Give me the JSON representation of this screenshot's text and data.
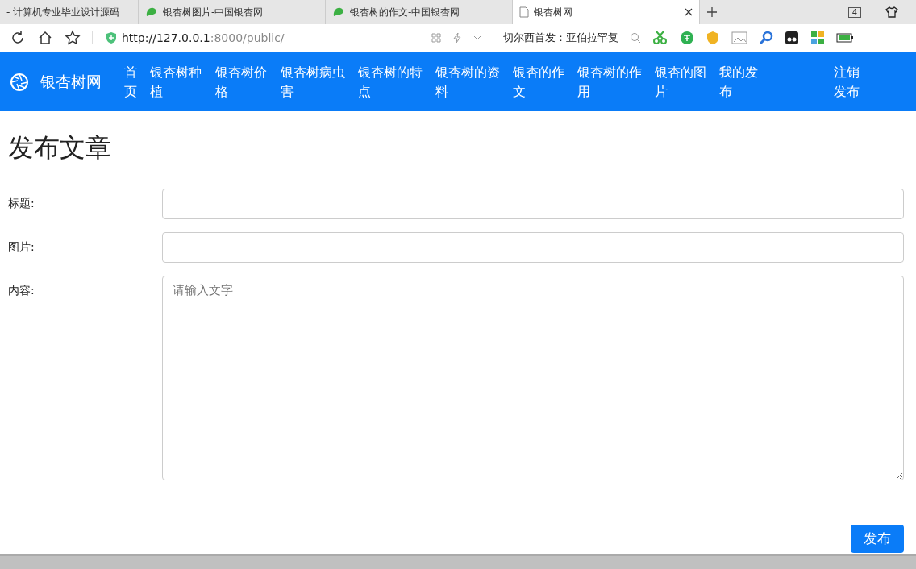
{
  "browser": {
    "tabs": [
      {
        "title": "- 计算机专业毕业设计源码",
        "kind": "plain",
        "selected": false
      },
      {
        "title": "银杏树图片-中国银杏网",
        "kind": "leaf",
        "selected": false
      },
      {
        "title": "银杏树的作文-中国银杏网",
        "kind": "leaf",
        "selected": false
      },
      {
        "title": "银杏树网",
        "kind": "page",
        "selected": true
      }
    ],
    "tab_count": "4",
    "url_host": "http://127.0.0.1",
    "url_rest": ":8000/public/",
    "search_text": "切尔西首发：亚伯拉罕复"
  },
  "navbar": {
    "brand": "银杏树网",
    "items": [
      {
        "label": "首页"
      },
      {
        "label": "银杏树种植"
      },
      {
        "label": "银杏树价格"
      },
      {
        "label": "银杏树病虫害"
      },
      {
        "label": "银杏树的特点"
      },
      {
        "label": "银杏树的资料"
      },
      {
        "label": "银杏的作文"
      },
      {
        "label": "银杏树的作用"
      },
      {
        "label": "银杏的图片"
      },
      {
        "label": "我的发布"
      }
    ],
    "right_items": [
      {
        "label": "注销"
      },
      {
        "label": "发布"
      }
    ]
  },
  "form": {
    "heading": "发布文章",
    "fields": [
      {
        "label": "标题:",
        "kind": "input"
      },
      {
        "label": "图片:",
        "kind": "input"
      },
      {
        "label": "内容:",
        "kind": "textarea",
        "placeholder": "请输入文字"
      }
    ],
    "submit": "发布"
  }
}
